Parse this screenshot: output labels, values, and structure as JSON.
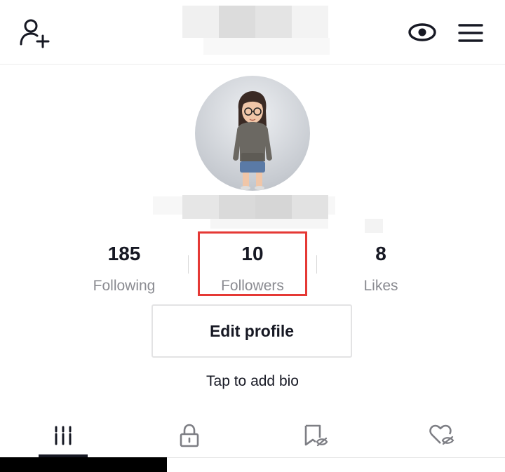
{
  "profile": {
    "avatar_icon": "avatar-memoji"
  },
  "stats": {
    "following": {
      "value": "185",
      "label": "Following"
    },
    "followers": {
      "value": "10",
      "label": "Followers"
    },
    "likes": {
      "value": "8",
      "label": "Likes"
    }
  },
  "buttons": {
    "edit_profile": "Edit profile"
  },
  "bio": {
    "placeholder": "Tap to add bio"
  },
  "tabs": [
    {
      "icon": "videos-grid-icon",
      "selected": true
    },
    {
      "icon": "lock-icon",
      "selected": false
    },
    {
      "icon": "bookmark-hidden-icon",
      "selected": false
    },
    {
      "icon": "heart-hidden-icon",
      "selected": false
    }
  ],
  "icons": {
    "top_left": "add-user-icon",
    "top_right_1": "eye-icon",
    "top_right_2": "menu-icon"
  },
  "colors": {
    "text_primary": "#161823",
    "text_secondary": "#8a8b91",
    "highlight": "#e53935"
  }
}
